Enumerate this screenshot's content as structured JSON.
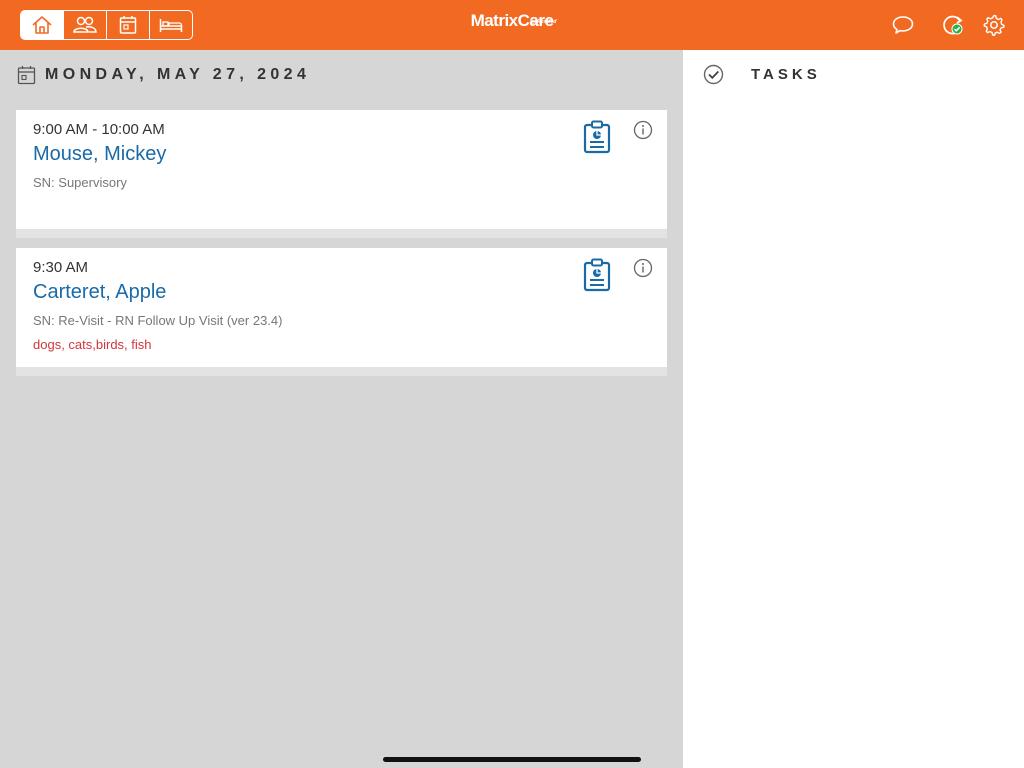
{
  "header": {
    "brand": "MatrixCare",
    "brand_sub": "by ResMed",
    "nav": [
      {
        "icon": "home-icon",
        "active": true
      },
      {
        "icon": "people-icon",
        "active": false
      },
      {
        "icon": "calendar-icon",
        "active": false
      },
      {
        "icon": "bed-icon",
        "active": false
      }
    ],
    "actions": [
      "chat-icon",
      "sync-check-icon",
      "gear-icon"
    ]
  },
  "schedule": {
    "date": "MONDAY, MAY 27, 2024",
    "visits": [
      {
        "time": "9:00 AM - 10:00 AM",
        "patient": "Mouse, Mickey",
        "service": "SN: Supervisory",
        "notes": ""
      },
      {
        "time": "9:30 AM",
        "patient": "Carteret, Apple",
        "service": "SN: Re-Visit - RN Follow Up Visit (ver 23.4)",
        "notes": "dogs, cats,birds, fish"
      }
    ]
  },
  "tasks": {
    "title": "TASKS"
  },
  "colors": {
    "brand": "#f26a22",
    "link": "#1a6aa8",
    "alert": "#d0363a"
  }
}
